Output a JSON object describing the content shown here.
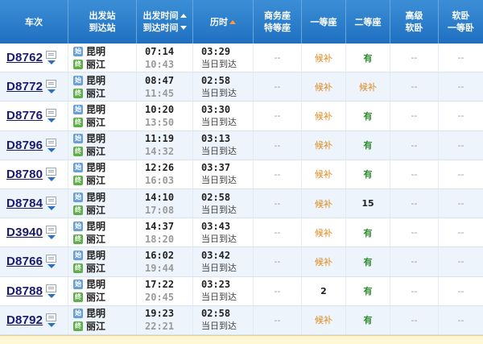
{
  "header": {
    "train": "车次",
    "station_from": "出发站",
    "station_to": "到达站",
    "time_dep": "出发时间",
    "time_arr": "到达时间",
    "duration": "历时",
    "business_1": "商务座",
    "business_2": "特等座",
    "first": "一等座",
    "second": "二等座",
    "soft_1": "高级",
    "soft_2": "软卧",
    "sleeper_1": "软卧",
    "sleeper_2": "一等卧"
  },
  "icons": {
    "train_card": "card-icon",
    "dropdown": "triangle-down-icon",
    "start_badge": "始",
    "end_badge": "终"
  },
  "rows": [
    {
      "train": "D8762",
      "from": "昆明",
      "to": "丽江",
      "dep": "07:14",
      "arr": "10:43",
      "dur": "03:29",
      "note": "当日到达",
      "biz": "--",
      "first": "候补",
      "second": "有",
      "soft": "--",
      "sleeper": "--"
    },
    {
      "train": "D8772",
      "from": "昆明",
      "to": "丽江",
      "dep": "08:47",
      "arr": "11:45",
      "dur": "02:58",
      "note": "当日到达",
      "biz": "--",
      "first": "候补",
      "second": "候补",
      "soft": "--",
      "sleeper": "--"
    },
    {
      "train": "D8776",
      "from": "昆明",
      "to": "丽江",
      "dep": "10:20",
      "arr": "13:50",
      "dur": "03:30",
      "note": "当日到达",
      "biz": "--",
      "first": "候补",
      "second": "有",
      "soft": "--",
      "sleeper": "--"
    },
    {
      "train": "D8796",
      "from": "昆明",
      "to": "丽江",
      "dep": "11:19",
      "arr": "14:32",
      "dur": "03:13",
      "note": "当日到达",
      "biz": "--",
      "first": "候补",
      "second": "有",
      "soft": "--",
      "sleeper": "--"
    },
    {
      "train": "D8780",
      "from": "昆明",
      "to": "丽江",
      "dep": "12:26",
      "arr": "16:03",
      "dur": "03:37",
      "note": "当日到达",
      "biz": "--",
      "first": "候补",
      "second": "有",
      "soft": "--",
      "sleeper": "--"
    },
    {
      "train": "D8784",
      "from": "昆明",
      "to": "丽江",
      "dep": "14:10",
      "arr": "17:08",
      "dur": "02:58",
      "note": "当日到达",
      "biz": "--",
      "first": "候补",
      "second": "15",
      "soft": "--",
      "sleeper": "--"
    },
    {
      "train": "D3940",
      "from": "昆明",
      "to": "丽江",
      "dep": "14:37",
      "arr": "18:20",
      "dur": "03:43",
      "note": "当日到达",
      "biz": "--",
      "first": "候补",
      "second": "有",
      "soft": "--",
      "sleeper": "--"
    },
    {
      "train": "D8766",
      "from": "昆明",
      "to": "丽江",
      "dep": "16:02",
      "arr": "19:44",
      "dur": "03:42",
      "note": "当日到达",
      "biz": "--",
      "first": "候补",
      "second": "有",
      "soft": "--",
      "sleeper": "--"
    },
    {
      "train": "D8788",
      "from": "昆明",
      "to": "丽江",
      "dep": "17:22",
      "arr": "20:45",
      "dur": "03:23",
      "note": "当日到达",
      "biz": "--",
      "first": "2",
      "second": "有",
      "soft": "--",
      "sleeper": "--"
    },
    {
      "train": "D8792",
      "from": "昆明",
      "to": "丽江",
      "dep": "19:23",
      "arr": "22:21",
      "dur": "02:58",
      "note": "当日到达",
      "biz": "--",
      "first": "候补",
      "second": "有",
      "soft": "--",
      "sleeper": "--"
    }
  ]
}
